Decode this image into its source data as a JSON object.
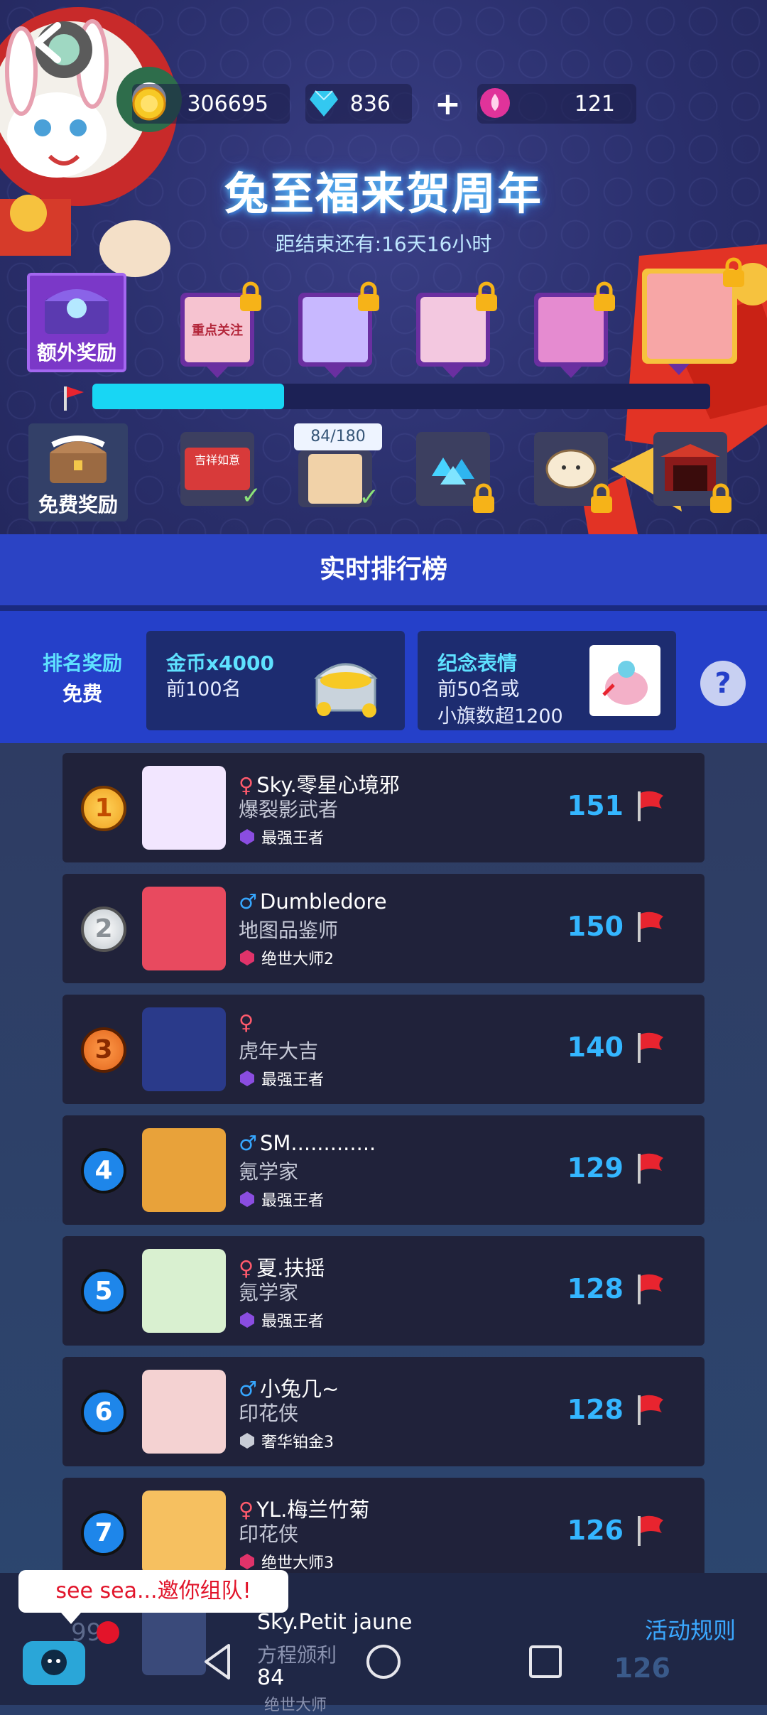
{
  "header": {
    "coins": "306695",
    "diamonds": "836",
    "lotus": "121",
    "event_title": "兔至福来贺周年",
    "countdown": "距结束还有:16天16小时"
  },
  "rewards": {
    "extra_label": "额外奖励",
    "free_label": "免费奖励",
    "progress_text": "84/180",
    "progress_fraction": 0.31,
    "extra_item_caption": "重点关注",
    "free_item_caption": "吉祥如意"
  },
  "ranking": {
    "header": "实时排行榜",
    "rank_reward_label": "排名奖励",
    "rank_reward_type": "免费",
    "reward1_title": "金币x4000",
    "reward1_desc": "前100名",
    "reward2_title": "纪念表情",
    "reward2_desc_line1": "前50名或",
    "reward2_desc_line2": "小旗数超1200",
    "help": "?"
  },
  "players": [
    {
      "rank": "1",
      "gender": "♀",
      "name": "Sky.零星心境邪",
      "title": "爆裂影武者",
      "tier": "最强王者",
      "score": "151"
    },
    {
      "rank": "2",
      "gender": "♂",
      "name": "Dumbledore",
      "title": "地图品鉴师",
      "tier": "绝世大师2",
      "score": "150"
    },
    {
      "rank": "3",
      "gender": "♀",
      "name": "",
      "title": "虎年大吉",
      "tier": "最强王者",
      "score": "140"
    },
    {
      "rank": "4",
      "gender": "♂",
      "name": "SM.............",
      "title": "氪学家",
      "tier": "最强王者",
      "score": "129"
    },
    {
      "rank": "5",
      "gender": "♀",
      "name": "夏.扶摇",
      "title": "氪学家",
      "tier": "最强王者",
      "score": "128"
    },
    {
      "rank": "6",
      "gender": "♂",
      "name": "小兔几~",
      "title": "印花侠",
      "tier": "奢华铂金3",
      "score": "128"
    },
    {
      "rank": "7",
      "gender": "♀",
      "name": "YL.梅兰竹菊",
      "title": "印花侠",
      "tier": "绝世大师3",
      "score": "126"
    }
  ],
  "bottom": {
    "invite_text": "see sea...邀你组队!",
    "self_rank": "99",
    "self_name": "Sky.Petit jaune",
    "self_title": "方程颁利",
    "self_score": "126",
    "self_flags": "84",
    "self_tier": "绝世大师",
    "rules_link": "活动规则"
  },
  "colors": {
    "accent": "#2b43c4",
    "score": "#34b6ff",
    "progress": "#18d6f4"
  }
}
